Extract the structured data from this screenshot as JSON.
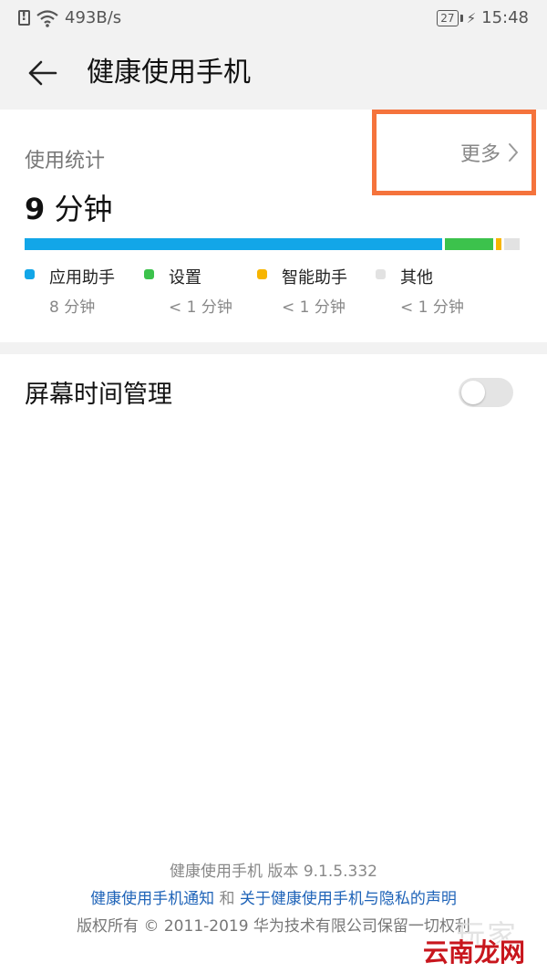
{
  "status_bar": {
    "net_speed": "493B/s",
    "battery": "27",
    "time": "15:48",
    "icons": [
      "alert-icon",
      "wifi-icon",
      "battery-icon",
      "charging-bolt-icon"
    ]
  },
  "app_bar": {
    "title": "健康使用手机",
    "back_icon": "arrow-left-icon"
  },
  "stats": {
    "label": "使用统计",
    "more_label": "更多",
    "more_icon": "chevron-right-icon",
    "highlight_color": "#f5733c",
    "total_value": "9",
    "total_unit": "分钟",
    "categories": [
      {
        "name": "应用助手",
        "value": "8 分钟",
        "color": "#12a6e8",
        "share": 0.852
      },
      {
        "name": "设置",
        "value": "< 1 分钟",
        "color": "#3cc24c",
        "share": 0.098
      },
      {
        "name": "智能助手",
        "value": "< 1 分钟",
        "color": "#f7b500",
        "share": 0.012
      },
      {
        "name": "其他",
        "value": "< 1 分钟",
        "color": "#e2e2e2",
        "share": 0.031
      }
    ]
  },
  "screen_time": {
    "label": "屏幕时间管理",
    "enabled": false
  },
  "footer": {
    "version_line": "健康使用手机 版本 9.1.5.332",
    "notice_link": "健康使用手机通知",
    "and_text": " 和 ",
    "privacy_link": "关于健康使用手机与隐私的声明",
    "copyright": "版权所有 © 2011-2019 华为技术有限公司保留一切权利"
  },
  "watermark": {
    "text": "云南龙网",
    "faint_text": "玩家"
  }
}
